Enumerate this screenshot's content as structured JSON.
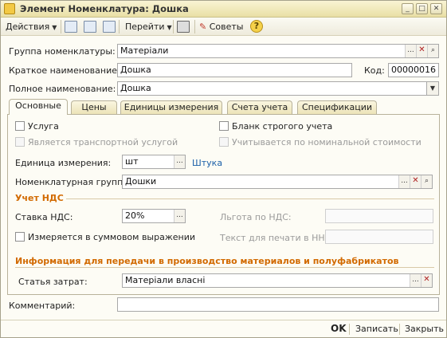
{
  "window": {
    "title": "Элемент Номенклатура: Дошка"
  },
  "toolbar": {
    "actions_label": "Действия",
    "goto_label": "Перейти",
    "tips_label": "Советы",
    "help_symbol": "?"
  },
  "fields": {
    "group_label": "Группа номенклатуры:",
    "group_value": "Матеріали",
    "short_name_label": "Краткое наименование:",
    "short_name_value": "Дошка",
    "code_label": "Код:",
    "code_value": "00000016",
    "full_name_label": "Полное наименование:",
    "full_name_value": "Дошка"
  },
  "tabs": [
    {
      "label": "Основные",
      "active": true
    },
    {
      "label": "Цены",
      "active": false
    },
    {
      "label": "Единицы измерения",
      "active": false
    },
    {
      "label": "Счета учета",
      "active": false
    },
    {
      "label": "Спецификации",
      "active": false
    }
  ],
  "main": {
    "service_label": "Услуга",
    "service_checked": false,
    "transport_label": "Является транспортной услугой",
    "strict_form_label": "Бланк строгого учета",
    "strict_form_checked": false,
    "nominal_label": "Учитывается по номинальной стоимости",
    "unit_label": "Единица измерения:",
    "unit_value": "шт",
    "unit_link": "Штука",
    "nomenclature_group_label": "Номенклатурная группа:",
    "nomenclature_group_value": "Дошки",
    "vat_section": "Учет НДС",
    "vat_rate_label": "Ставка НДС:",
    "vat_rate_value": "20%",
    "vat_benefit_label": "Льгота по НДС:",
    "sum_expression_label": "Измеряется в суммовом выражении",
    "sum_expression_checked": false,
    "print_text_label": "Текст для печати в НН:",
    "production_section": "Информация для передачи в производство материалов и полуфабрикатов",
    "cost_item_label": "Статья затрат:",
    "cost_item_value": "Матеріали власні"
  },
  "comment": {
    "label": "Комментарий:",
    "value": ""
  },
  "footer": {
    "ok_label": "OK",
    "save_label": "Записать",
    "close_label": "Закрыть"
  },
  "icons": {
    "ellipsis": "...",
    "clear": "✕",
    "search": "🔍",
    "dropdown": "▼"
  }
}
